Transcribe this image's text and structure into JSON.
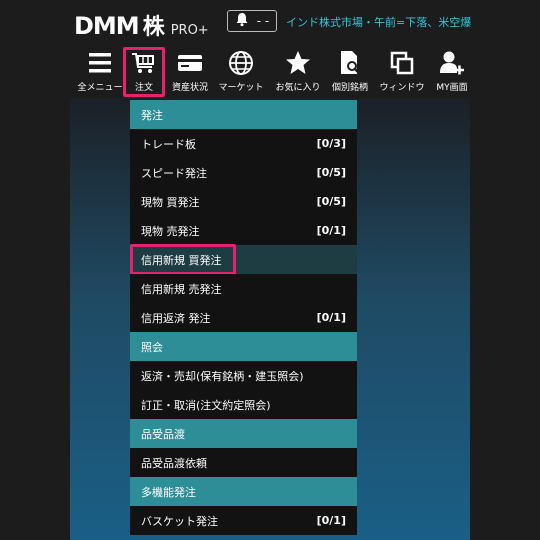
{
  "header": {
    "logo_dmm": "DMM",
    "logo_kabu": "株",
    "logo_pro": "PRO+",
    "notification_value": "- -",
    "market_status": "インド株式市場・午前=下落、米空爆"
  },
  "toolbar": {
    "items": [
      {
        "label": "全メニュー",
        "icon": "hamburger-menu-icon"
      },
      {
        "label": "注文",
        "icon": "cart-icon",
        "active": true
      },
      {
        "label": "資産状況",
        "icon": "wallet-card-icon"
      },
      {
        "label": "マーケット",
        "icon": "globe-icon"
      },
      {
        "label": "お気に入り",
        "icon": "star-icon"
      },
      {
        "label": "個別銘柄",
        "icon": "document-search-icon"
      },
      {
        "label": "ウィンドウ",
        "icon": "windows-icon"
      },
      {
        "label": "MY画面",
        "icon": "user-plus-icon"
      }
    ]
  },
  "menu": {
    "sections": [
      {
        "title": "発注",
        "items": [
          {
            "label": "トレード板",
            "count": "[0/3]"
          },
          {
            "label": "スピード発注",
            "count": "[0/5]"
          },
          {
            "label": "現物 買発注",
            "count": "[0/5]"
          },
          {
            "label": "現物 売発注",
            "count": "[0/1]"
          },
          {
            "label": "信用新規 買発注",
            "count": ""
          },
          {
            "label": "信用新規 売発注",
            "count": ""
          },
          {
            "label": "信用返済 発注",
            "count": "[0/1]"
          }
        ]
      },
      {
        "title": "照会",
        "items": [
          {
            "label": "返済・売却(保有銘柄・建玉照会)",
            "count": ""
          },
          {
            "label": "訂正・取消(注文約定照会)",
            "count": ""
          }
        ]
      },
      {
        "title": "品受品渡",
        "items": [
          {
            "label": "品受品渡依頼",
            "count": ""
          }
        ]
      },
      {
        "title": "多機能発注",
        "items": [
          {
            "label": "バスケット発注",
            "count": "[0/1]"
          }
        ]
      }
    ]
  },
  "colors": {
    "highlight": "#e6226c",
    "section_bg": "#2e8e98",
    "status_text": "#2fc6d8"
  }
}
